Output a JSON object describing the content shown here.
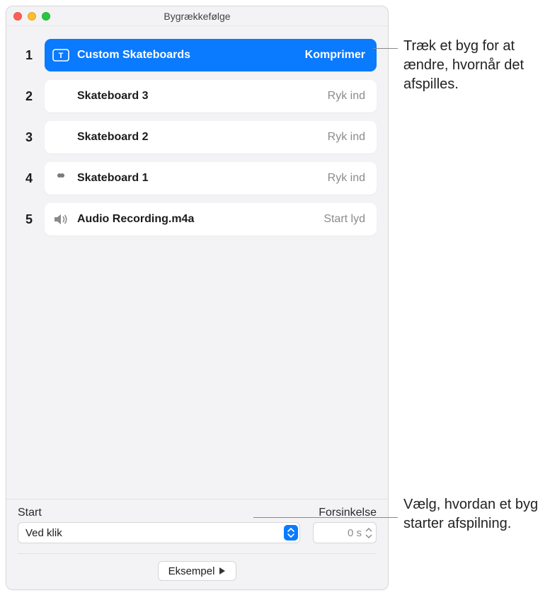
{
  "window": {
    "title": "Bygrækkefølge"
  },
  "builds": [
    {
      "n": "1",
      "name": "Custom Skateboards",
      "action": "Komprimer",
      "icon": "text",
      "selected": true
    },
    {
      "n": "2",
      "name": "Skateboard 3",
      "action": "Ryk ind",
      "icon": "img1",
      "selected": false
    },
    {
      "n": "3",
      "name": "Skateboard 2",
      "action": "Ryk ind",
      "icon": "img2",
      "selected": false
    },
    {
      "n": "4",
      "name": "Skateboard 1",
      "action": "Ryk ind",
      "icon": "img3",
      "selected": false
    },
    {
      "n": "5",
      "name": "Audio Recording.m4a",
      "action": "Start lyd",
      "icon": "audio",
      "selected": false
    }
  ],
  "controls": {
    "start_label": "Start",
    "start_value": "Ved klik",
    "delay_label": "Forsinkelse",
    "delay_value": "0 s"
  },
  "preview_label": "Eksempel",
  "callouts": {
    "drag": "Træk et byg for at ændre, hvornår det afspilles.",
    "start": "Vælg, hvordan et byg starter afspilning."
  }
}
